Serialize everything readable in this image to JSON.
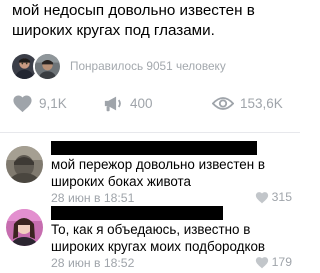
{
  "post": {
    "text": "мой недосып довольно известен в широких кругах под глазами.",
    "likes_summary": "Понравилось 9051 человеку"
  },
  "actions": {
    "likes": "9,1K",
    "reposts": "400",
    "views": "153,6K"
  },
  "comments": [
    {
      "text": "мой пережор довольно известен в широких боках живота",
      "date": "28 июн в 18:51",
      "likes": "315"
    },
    {
      "text": "То, как я объедаюсь, известно в широких кругах моих подбородков",
      "date": "28 июн в 18:52",
      "likes": "179"
    }
  ],
  "colors": {
    "secondary_text": "#9fa4aa",
    "redaction": "#000000",
    "divider": "#e7e8ec"
  },
  "icons": {
    "like": "heart-icon",
    "repost": "megaphone-icon",
    "views": "eye-icon",
    "comment_like": "heart-icon"
  }
}
